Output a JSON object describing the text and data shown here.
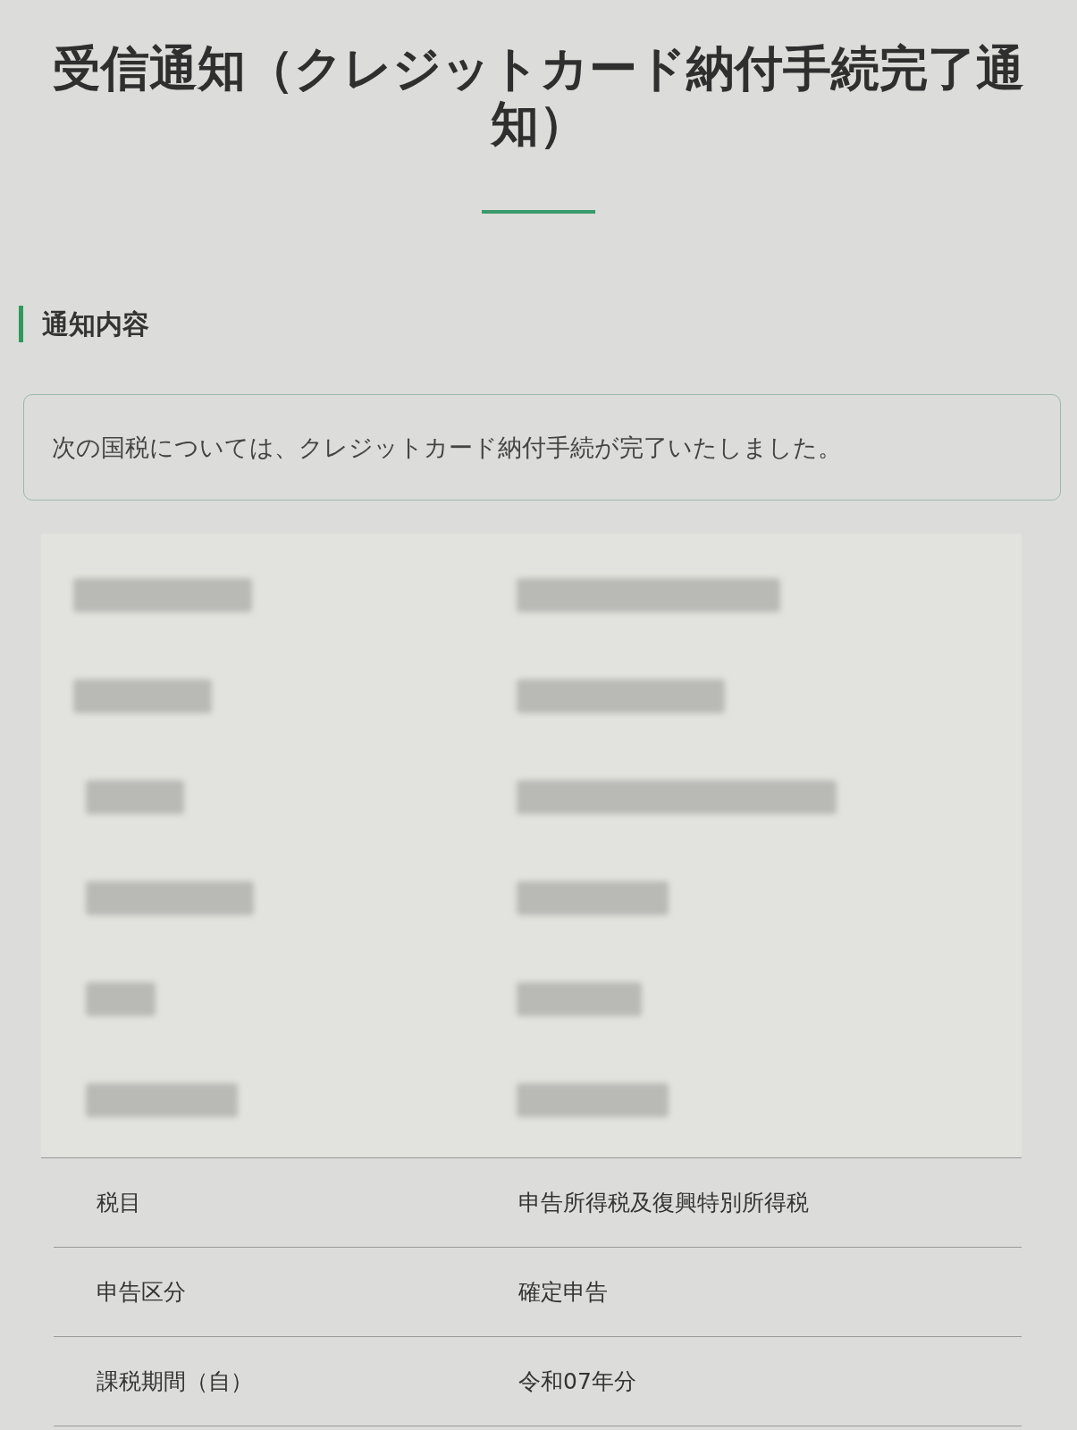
{
  "page": {
    "title": "受信通知（クレジットカード納付手続完了通知）"
  },
  "section": {
    "heading": "通知内容"
  },
  "notice": {
    "message": "次の国税については、クレジットカード納付手続が完了いたしました。"
  },
  "details": {
    "rows": [
      {
        "label": "税目",
        "value": "申告所得税及復興特別所得税"
      },
      {
        "label": "申告区分",
        "value": "確定申告"
      },
      {
        "label": "課税期間（自）",
        "value": "令和07年分"
      }
    ]
  }
}
